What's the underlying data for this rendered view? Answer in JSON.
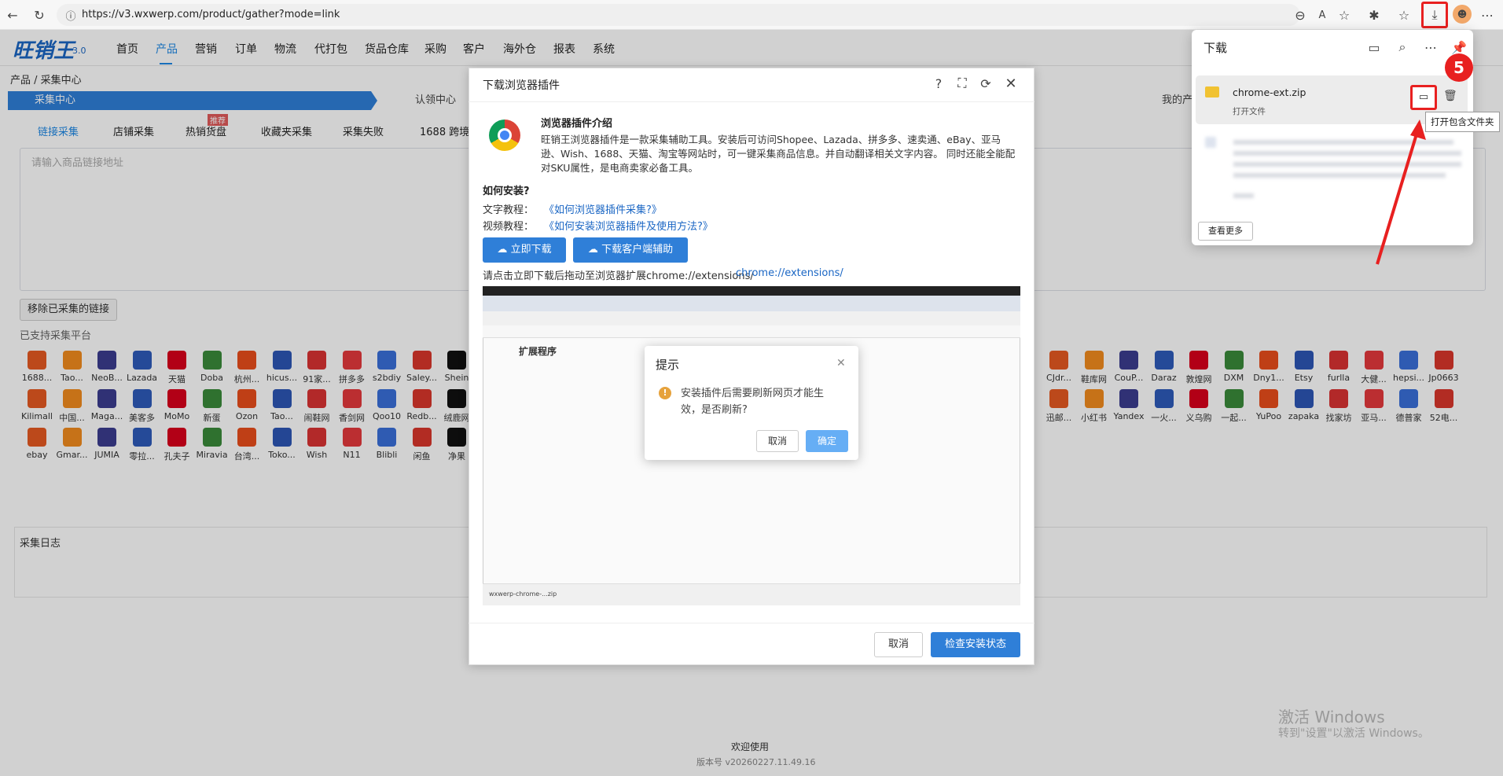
{
  "browser": {
    "url": "https://v3.wxwerp.com/product/gather?mode=link"
  },
  "app": {
    "logo": "旺销王",
    "logo_version": "3.0",
    "nav": [
      "首页",
      "产品",
      "营销",
      "订单",
      "物流",
      "代打包",
      "货品仓库",
      "采购",
      "客户",
      "海外仓",
      "报表",
      "系统"
    ],
    "breadcrumb": "产品 / 采集中心",
    "steps": [
      "采集中心",
      "认领中心",
      "我的产品"
    ],
    "subtabs": [
      "链接采集",
      "店铺采集",
      "热销货盘",
      "收藏夹采集",
      "采集失败",
      "1688 跨境电"
    ],
    "hot_badge": "推荐",
    "input_placeholder": "请输入商品链接地址",
    "remove_button": "移除已采集的链接",
    "platforms_label": "已支持采集平台",
    "platforms_row1_left": [
      "1688...",
      "Tao...",
      "NeoB...",
      "Lazada",
      "天猫",
      "Doba",
      "杭州...",
      "hicus...",
      "91家...",
      "拼多多",
      "s2bdiy",
      "Saley...",
      "Shein"
    ],
    "platforms_row2_left": [
      "Kilimall",
      "中国...",
      "Maga...",
      "美客多",
      "MoMo",
      "新蛋",
      "Ozon",
      "Tao...",
      "闹鞋网",
      "香剑网",
      "Qoo10",
      "Redb...",
      "绒鹿网"
    ],
    "platforms_row3_left": [
      "ebay",
      "Gmar...",
      "JUMIA",
      "零拉...",
      "孔夫子",
      "Miravia",
      "台湾...",
      "Toko...",
      "Wish",
      "N11",
      "Blibli",
      "闲鱼",
      "净果"
    ],
    "platforms_row1_right": [
      "CJdr...",
      "鞋库网",
      "CouP...",
      "Daraz",
      "敦煌网",
      "DXM",
      "Dny1...",
      "Etsy",
      "furlla",
      "大健...",
      "hepsi...",
      "Jp0663"
    ],
    "platforms_row2_right": [
      "迅邮...",
      "小红书",
      "Yandex",
      "一火...",
      "义乌购",
      "一起...",
      "YuPoo",
      "zapaka",
      "找家坊",
      "亚马...",
      "德普家",
      "52电..."
    ],
    "log_title": "采集日志",
    "footer_welcome": "欢迎使用",
    "footer_version": "版本号 v20260227.11.49.16",
    "windows_activate_1": "激活 Windows",
    "windows_activate_2": "转到\"设置\"以激活 Windows。"
  },
  "plugin_dialog": {
    "title": "下载浏览器插件",
    "intro_title": "浏览器插件介绍",
    "intro_text": "旺销王浏览器插件是一款采集辅助工具。安装后可访问Shopee、Lazada、拼多多、速卖通、eBay、亚马逊、Wish、1688、天猫、淘宝等网站时，可一键采集商品信息。并自动翻译相关文字内容。 同时还能全能配对SKU属性，是电商卖家必备工具。",
    "how_title": "如何安装?",
    "text_tutorial_label": "文字教程：",
    "text_tutorial_link": "《如何浏览器插件采集?》",
    "video_tutorial_label": "视频教程：",
    "video_tutorial_link": "《如何安装浏览器插件及使用方法?》",
    "download_now": "立即下载",
    "download_client": "下载客户端辅助",
    "after_download": "请点击立即下载后拖动至浏览器扩展chrome://extensions/",
    "after_download_link": "chrome://extensions/",
    "shot_ext_title": "扩展程序",
    "shot_dl_file": "wxwerp-chrome-...zip",
    "cancel": "取消",
    "check_status": "检查安装状态"
  },
  "alert": {
    "title": "提示",
    "message": "安装插件后需要刷新网页才能生效，是否刷新?",
    "cancel": "取消",
    "ok": "确定"
  },
  "download_panel": {
    "title": "下载",
    "file_name": "chrome-ext.zip",
    "open_file": "打开文件",
    "tooltip": "打开包含文件夹",
    "see_more": "查看更多",
    "badge": "5"
  }
}
